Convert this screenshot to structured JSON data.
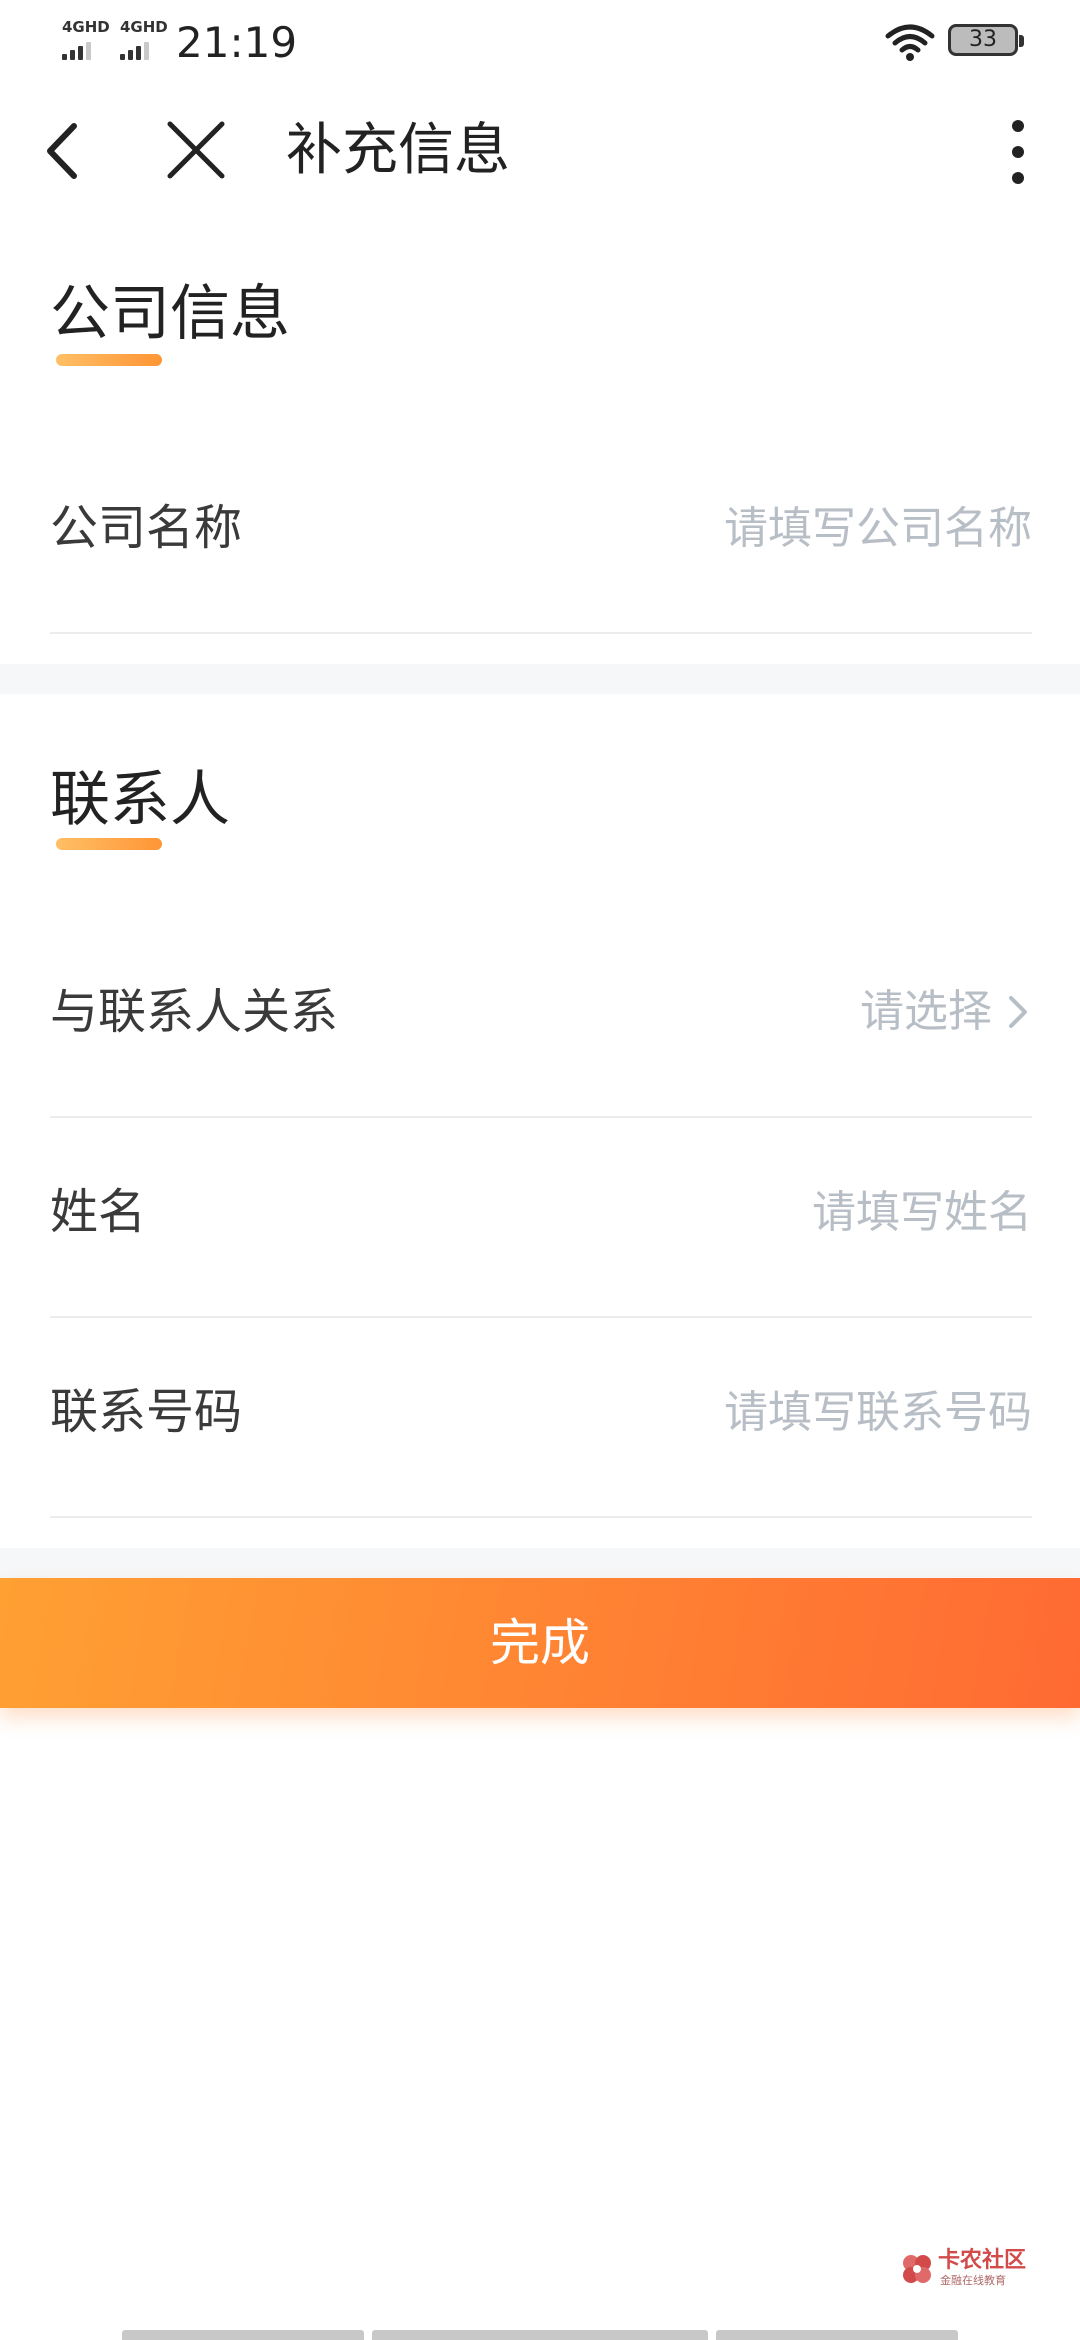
{
  "status_bar": {
    "network_1": "4GHD",
    "network_2": "4GHD",
    "time": "21:19",
    "battery": "33"
  },
  "nav": {
    "title": "补充信息"
  },
  "company_section": {
    "title": "公司信息",
    "fields": [
      {
        "label": "公司名称",
        "placeholder": "请填写公司名称",
        "value": ""
      }
    ]
  },
  "contact_section": {
    "title": "联系人",
    "relation": {
      "label": "与联系人关系",
      "placeholder": "请选择"
    },
    "fields": [
      {
        "label": "姓名",
        "placeholder": "请填写姓名",
        "value": ""
      },
      {
        "label": "联系号码",
        "placeholder": "请填写联系号码",
        "value": ""
      }
    ]
  },
  "actions": {
    "done_label": "完成"
  },
  "watermark": {
    "text": "卡农社区",
    "subtext": "金融在线教育"
  },
  "colors": {
    "accent_start": "#ffa033",
    "accent_end": "#ff6a33",
    "placeholder": "#b8bec6",
    "underline": "#ff9535"
  }
}
